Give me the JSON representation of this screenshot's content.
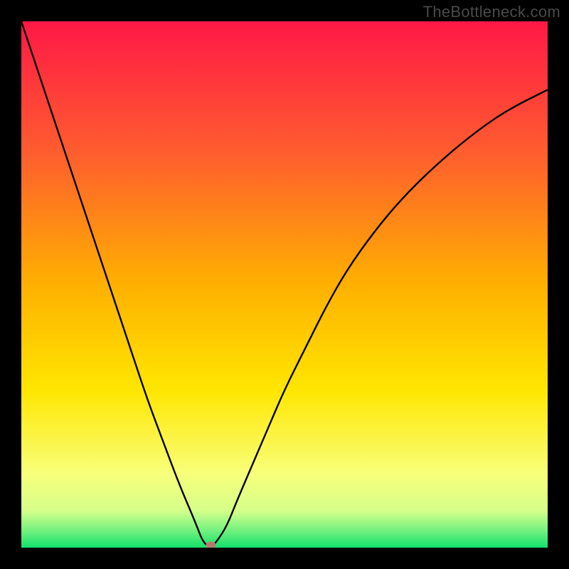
{
  "watermark": "TheBottleneck.com",
  "colors": {
    "top": "#ff1846",
    "upper_mid": "#ff7a2e",
    "mid": "#ffd600",
    "lower_mid": "#fff45a",
    "green": "#12e06a",
    "background": "#000000",
    "curve": "#000000",
    "marker": "#b97a6e"
  },
  "chart_data": {
    "type": "line",
    "title": "",
    "xlabel": "",
    "ylabel": "",
    "xlim": [
      0,
      100
    ],
    "ylim": [
      0,
      100
    ],
    "series": [
      {
        "name": "bottleneck-curve",
        "x": [
          0,
          3,
          6,
          9,
          12,
          15,
          18,
          21,
          24,
          27,
          30,
          33,
          34.5,
          36,
          37,
          39,
          41,
          44,
          47,
          50,
          54,
          58,
          62,
          67,
          72,
          78,
          85,
          92,
          100
        ],
        "values": [
          100,
          91,
          82,
          73,
          64,
          55,
          46,
          37,
          28,
          20,
          12,
          5,
          1,
          0,
          1,
          4,
          9,
          16,
          23,
          30,
          38,
          46,
          53,
          60,
          66,
          72,
          78,
          83,
          87
        ]
      }
    ],
    "marker": {
      "x": 36,
      "y": 0.5
    },
    "gradient_stops": [
      {
        "offset": 0,
        "color": "#ff1846"
      },
      {
        "offset": 24,
        "color": "#ff5a30"
      },
      {
        "offset": 50,
        "color": "#ffb000"
      },
      {
        "offset": 70,
        "color": "#ffe600"
      },
      {
        "offset": 86,
        "color": "#f8ff7a"
      },
      {
        "offset": 93,
        "color": "#d6ff8a"
      },
      {
        "offset": 97,
        "color": "#6cf07e"
      },
      {
        "offset": 100,
        "color": "#12e06a"
      }
    ]
  }
}
